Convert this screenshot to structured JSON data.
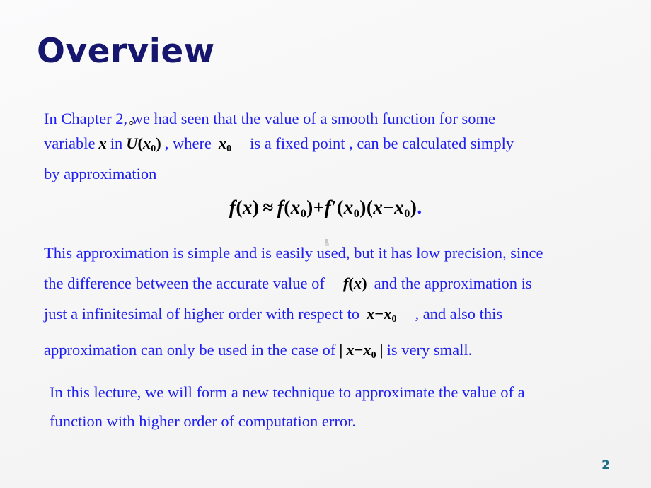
{
  "slide": {
    "title": "Overview",
    "page_number": "2",
    "colors": {
      "title": "#16166e",
      "body_text": "#2020f0",
      "math": "#000000",
      "page_number": "#1f6f87",
      "background": "#f5f5f5"
    }
  },
  "paragraph1": {
    "line1": "In Chapter 2, we had seen that the value of a smooth function for some",
    "line2_a": "variable",
    "line2_var_x": "x",
    "line2_b": "in",
    "line2_math_u": "U",
    "line2_math_u_open": "(",
    "line2_math_u_x": "x",
    "line2_math_u_sub": "0",
    "line2_math_u_close": ")",
    "line2_c": ", where",
    "line2_math_x0_x": "x",
    "line2_math_x0_sub": "0",
    "line2_d": "is a fixed point , can be calculated simply",
    "line3": "by approximation"
  },
  "display_equation": {
    "f": "f",
    "open1": "(",
    "x1": "x",
    "close1": ")",
    "approx": "≈",
    "f2": "f",
    "open2": "(",
    "x2": "x",
    "sub2": "0",
    "close2": ")",
    "plus": "+",
    "f3": "f",
    "prime": "′",
    "open3": "(",
    "x3": "x",
    "sub3": "0",
    "close3": ")",
    "open4": "(",
    "x4": "x",
    "minus": "−",
    "x5": "x",
    "sub5": "0",
    "close4": ")",
    "period": ".",
    "plain_text": "f(x) ≈ f(x₀) + f′(x₀)(x − x₀)."
  },
  "paragraph2": {
    "line1": "This approximation is simple and is easily used, but it has low precision, since",
    "line2_a": "the difference between the accurate value of",
    "line2_math_f": "f",
    "line2_math_open": "(",
    "line2_math_x": "x",
    "line2_math_close": ")",
    "line2_b": "and the approximation is",
    "line3_a": "just a infinitesimal of higher order with respect to",
    "line3_math_x": "x",
    "line3_math_minus": "−",
    "line3_math_x0": "x",
    "line3_math_sub": "0",
    "line3_b": ", and  also  this",
    "line4_a": "approximation can only be used in the case of",
    "line4_bar_open": "|",
    "line4_math_x": "x",
    "line4_math_minus": "−",
    "line4_math_x0": "x",
    "line4_math_sub": "0",
    "line4_bar_close": "|",
    "line4_b": "is very small."
  },
  "paragraph3": {
    "line1": "In this lecture, we will form a new technique to approximate the value of a",
    "line2": "function with higher order of computation error."
  }
}
